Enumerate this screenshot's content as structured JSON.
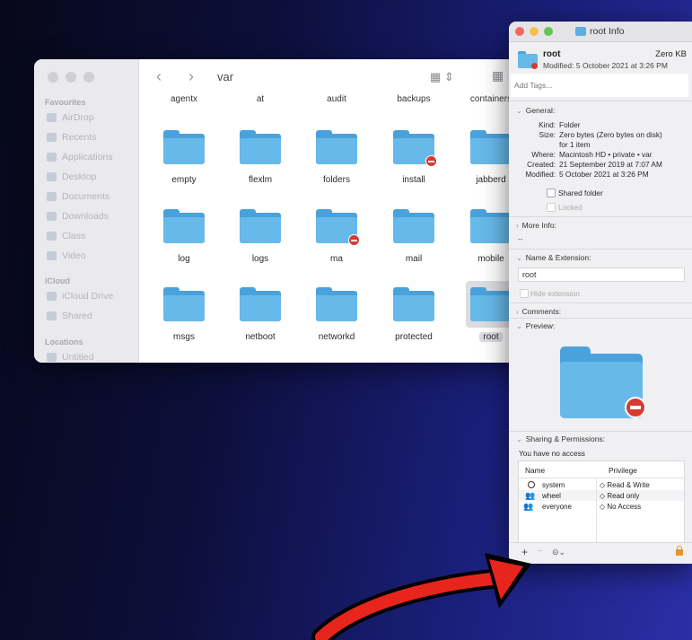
{
  "finder": {
    "path_title": "var",
    "nav_back": "‹",
    "nav_forward": "›",
    "view_icon": "grid-view-icon",
    "sidebar": {
      "favourites_heading": "Favourites",
      "favourites": [
        "AirDrop",
        "Recents",
        "Applications",
        "Desktop",
        "Documents",
        "Downloads",
        "Class",
        "Video"
      ],
      "icloud_heading": "iCloud",
      "icloud": [
        "iCloud Drive",
        "Shared"
      ],
      "locations_heading": "Locations",
      "locations": [
        "Untitled"
      ]
    },
    "top_row": [
      "agentx",
      "at",
      "audit",
      "backups",
      "containers"
    ],
    "folders": [
      {
        "name": "empty",
        "restricted": false
      },
      {
        "name": "flexlm",
        "restricted": false
      },
      {
        "name": "folders",
        "restricted": false
      },
      {
        "name": "install",
        "restricted": true
      },
      {
        "name": "jabberd",
        "restricted": false
      },
      {
        "name": "log",
        "restricted": false
      },
      {
        "name": "logs",
        "restricted": false
      },
      {
        "name": "ma",
        "restricted": true
      },
      {
        "name": "mail",
        "restricted": false
      },
      {
        "name": "mobile",
        "restricted": false
      },
      {
        "name": "msgs",
        "restricted": false
      },
      {
        "name": "netboot",
        "restricted": false
      },
      {
        "name": "networkd",
        "restricted": false
      },
      {
        "name": "protected",
        "restricted": false
      },
      {
        "name": "root",
        "restricted": false,
        "selected": true
      }
    ]
  },
  "info": {
    "window_title": "root Info",
    "name": "root",
    "size_short": "Zero KB",
    "modified_line": "Modified: 5 October 2021 at 3:26 PM",
    "tags_placeholder": "Add Tags...",
    "general_title": "General:",
    "general": {
      "kind_label": "Kind:",
      "kind": "Folder",
      "size_label": "Size:",
      "size": "Zero bytes (Zero bytes on disk)",
      "items": "for 1 item",
      "where_label": "Where:",
      "where": "Macintosh HD • private • var",
      "created_label": "Created:",
      "created": "21 September 2019 at 7:07 AM",
      "modified_label": "Modified:",
      "modified": "5 October 2021 at 3:26 PM",
      "shared_folder": "Shared folder",
      "locked": "Locked"
    },
    "more_info_title": "More Info:",
    "more_info_value": "--",
    "name_ext_title": "Name & Extension:",
    "name_field": "root",
    "hide_extension": "Hide extension",
    "comments_title": "Comments:",
    "preview_title": "Preview:",
    "sharing_title": "Sharing & Permissions:",
    "access_note": "You have no access",
    "table_headers": {
      "name": "Name",
      "privilege": "Privilege"
    },
    "permissions": [
      {
        "name": "system",
        "privilege": "◇ Read & Write"
      },
      {
        "name": "wheel",
        "privilege": "◇ Read only"
      },
      {
        "name": "everyone",
        "privilege": "◇ No Access"
      }
    ],
    "add_btn": "+",
    "remove_btn": "−",
    "action_btn": "⊝⌄"
  },
  "colors": {
    "close": "#ed6a5e",
    "minimize": "#f5bf4f",
    "zoom": "#61c554",
    "folder": "#67b9ea",
    "arrow": "#e8251c"
  }
}
